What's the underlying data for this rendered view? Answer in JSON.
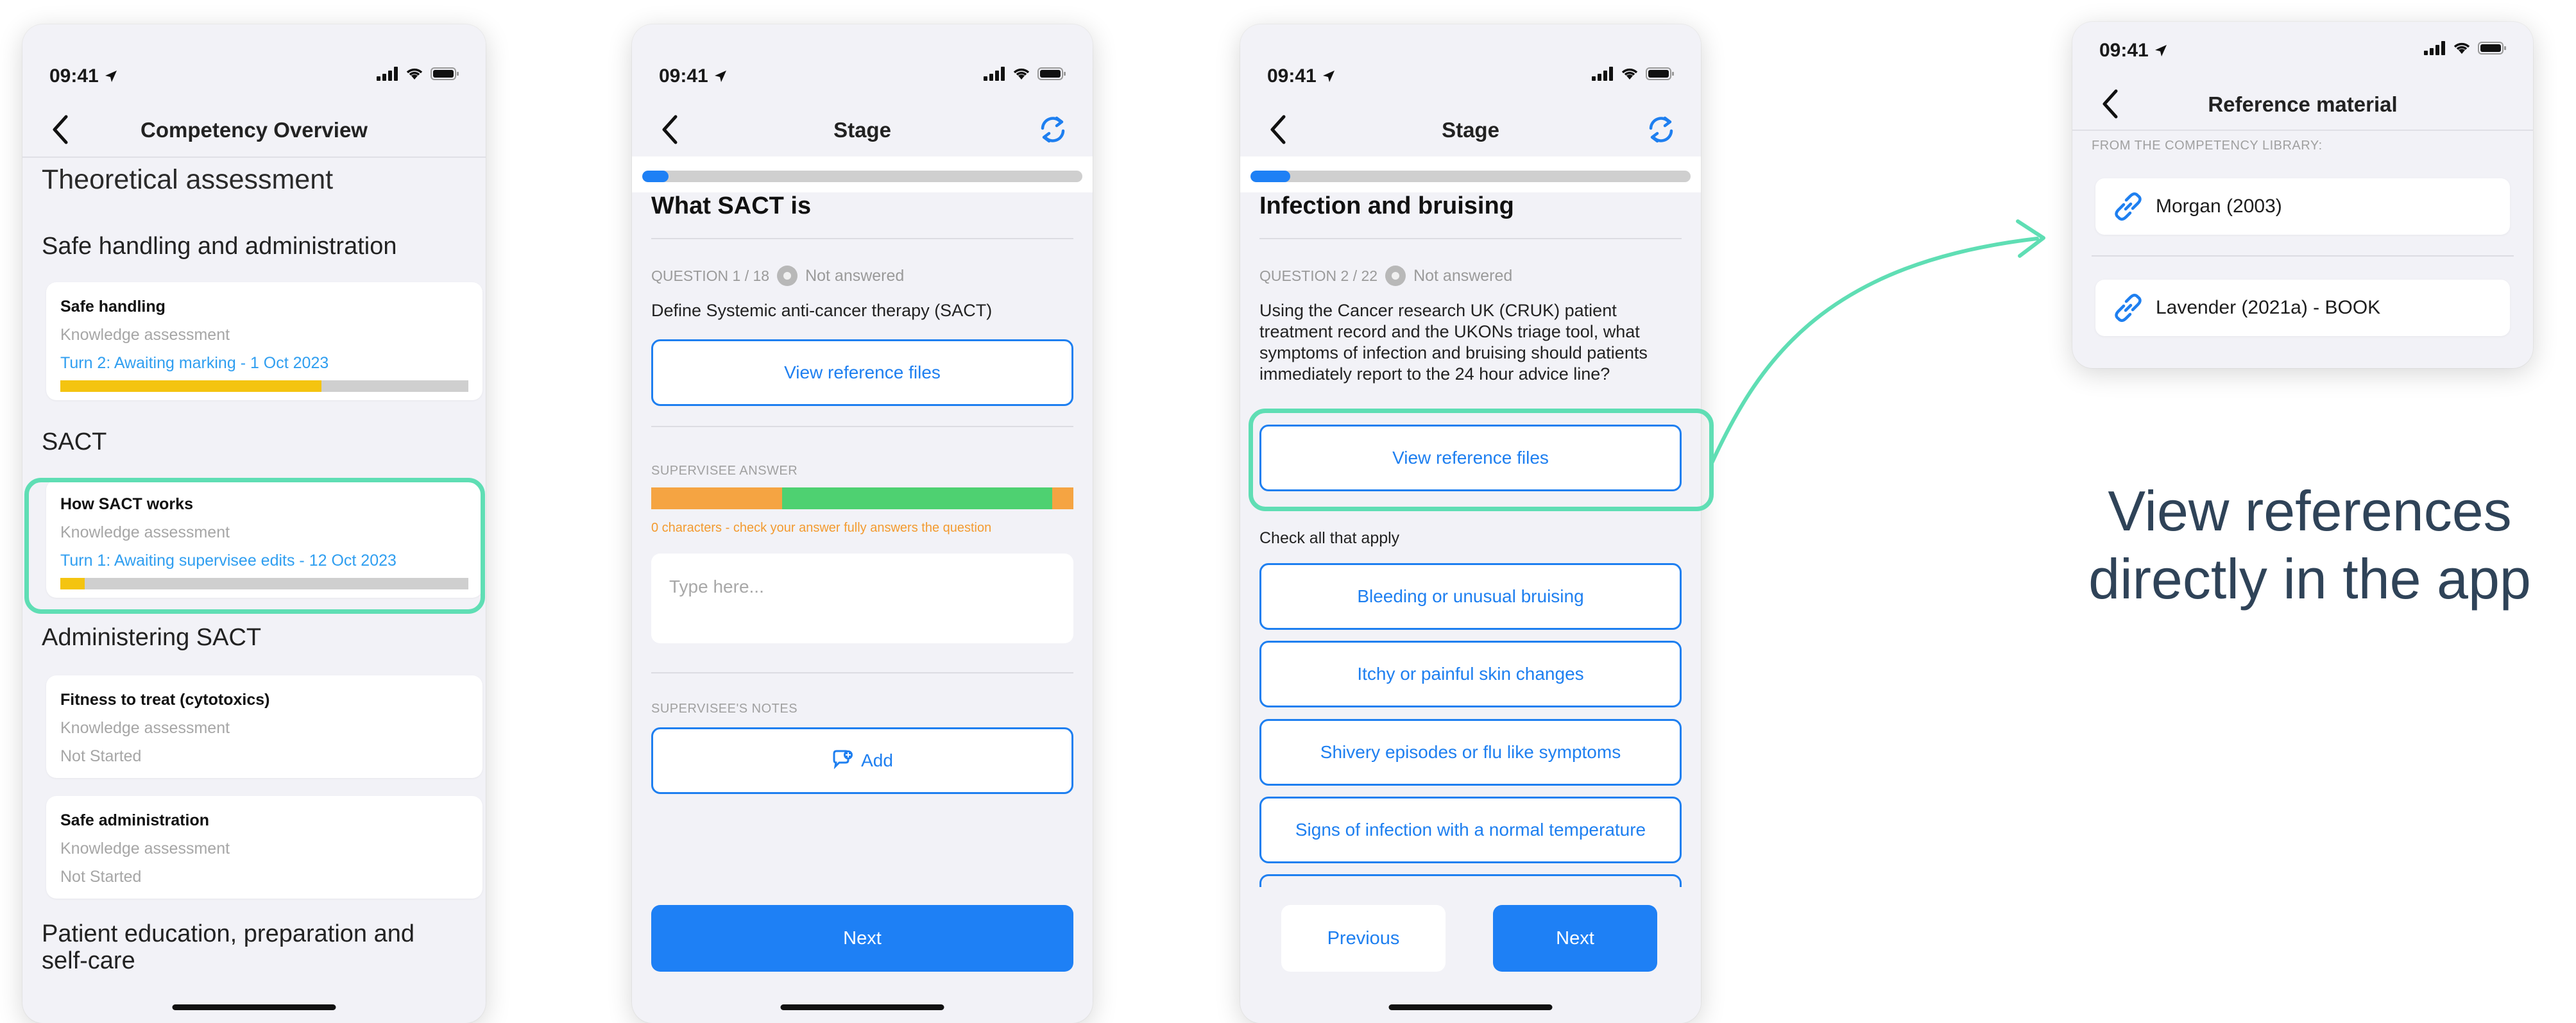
{
  "status_time": "09:41",
  "phone1": {
    "title": "Competency Overview",
    "heading": "Theoretical assessment",
    "sections": [
      {
        "name": "Safe handling and administration"
      },
      {
        "name": "SACT"
      },
      {
        "name": "Administering SACT"
      },
      {
        "name": "Patient education, preparation and self-care"
      }
    ],
    "cards": [
      {
        "title": "Safe handling",
        "type": "Knowledge assessment",
        "status": "Turn 2: Awaiting marking - 1 Oct 2023",
        "progress": 0.64
      },
      {
        "title": "How SACT works",
        "type": "Knowledge assessment",
        "status": "Turn 1: Awaiting supervisee edits - 12 Oct 2023",
        "progress": 0.06
      },
      {
        "title": "Fitness to treat (cytotoxics)",
        "type": "Knowledge assessment",
        "status": "Not Started"
      },
      {
        "title": "Safe administration",
        "type": "Knowledge assessment",
        "status": "Not Started"
      }
    ]
  },
  "phone2": {
    "title": "Stage",
    "progress": 0.06,
    "question_title": "What SACT is",
    "question_meta": "QUESTION 1 / 18",
    "answer_status": "Not answered",
    "question_text": "Define Systemic anti-cancer therapy (SACT)",
    "view_ref_label": "View reference files",
    "answer_label": "SUPERVISEE ANSWER",
    "char_warning": "0 characters - check your answer fully answers the question",
    "answer_placeholder": "Type here...",
    "notes_label": "SUPERVISEE'S NOTES",
    "add_label": "Add",
    "next_label": "Next"
  },
  "phone3": {
    "title": "Stage",
    "progress": 0.09,
    "question_title": "Infection and bruising",
    "question_meta": "QUESTION 2 / 22",
    "answer_status": "Not answered",
    "question_text": "Using the Cancer research UK (CRUK) patient treatment record and the UKONs triage tool, what symptoms of infection and bruising should patients immediately report to the 24 hour advice line?",
    "view_ref_label": "View reference files",
    "check_label": "Check all that apply",
    "options": [
      "Bleeding or unusual bruising",
      "Itchy or painful skin changes",
      "Shivery episodes or flu like symptoms",
      "Signs of infection with a normal temperature"
    ],
    "previous_label": "Previous",
    "next_label": "Next"
  },
  "phone4": {
    "title": "Reference material",
    "library_label": "FROM THE COMPETENCY LIBRARY:",
    "references": [
      "Morgan (2003)",
      "Lavender (2021a) - BOOK"
    ]
  },
  "tagline": {
    "line1": "View references",
    "line2": "directly in the app"
  },
  "colors": {
    "accent": "#1e80f5",
    "highlight": "#5fdeb4",
    "progress_yellow": "#f4c410",
    "warning_orange": "#f5a442",
    "success_green": "#4ed171",
    "tagline": "#2f4358"
  }
}
